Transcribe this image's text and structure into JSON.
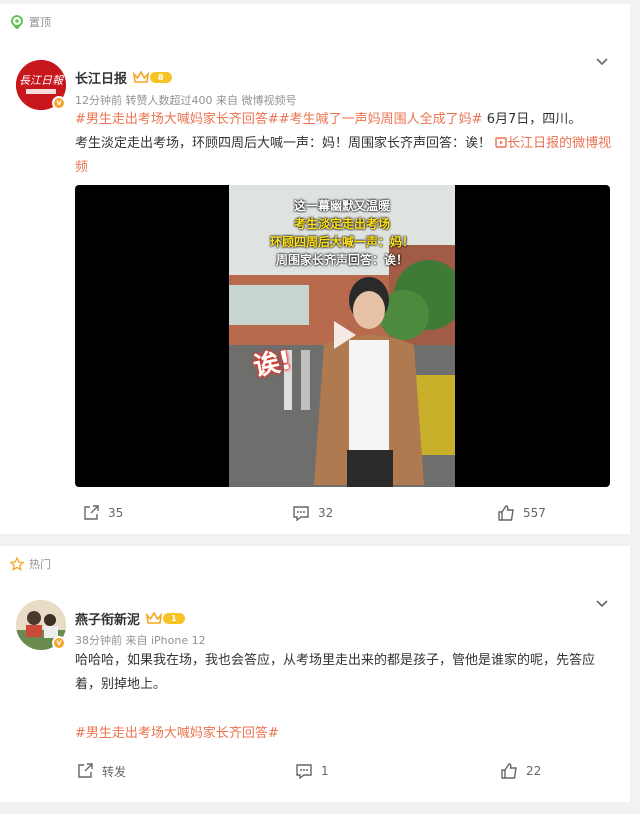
{
  "post1": {
    "tag_label": "置顶",
    "author": "长江日报",
    "level": "8",
    "meta": "12分钟前 转赞人数超过400  来自 微博视频号",
    "hashtags": "#男生走出考场大喊妈家长齐回答##考生喊了一声妈周围人全成了妈#",
    "body_text_1": " 6月7日，四川。",
    "body_text_2": "考生淡定走出考场，环顾四周后大喊一声：妈！周围家长齐声回答：诶！",
    "link_text": "长江日报的微博视频",
    "video": {
      "caption1": "这一幕幽默又温暖",
      "caption2": "考生淡定走出考场",
      "caption3": "环顾四周后大喊一声：妈！",
      "caption4": "周围家长齐声回答：诶！",
      "sticker": "诶!"
    },
    "actions": {
      "share": "35",
      "comment": "32",
      "like": "557"
    }
  },
  "post2": {
    "tag_label": "热门",
    "author": "燕子衔新泥",
    "level": "1",
    "meta": "38分钟前 来自 iPhone 12",
    "body_text": "哈哈哈，如果我在场，我也会答应，从考场里走出来的都是孩子，管他是谁家的呢，先答应着，别掉地上。",
    "hashtag": "#男生走出考场大喊妈家长齐回答#",
    "actions": {
      "share": "转发",
      "comment": "1",
      "like": "22"
    }
  },
  "colors": {
    "accent": "#eb7350",
    "muted": "#939393",
    "level": "#f7c325"
  }
}
